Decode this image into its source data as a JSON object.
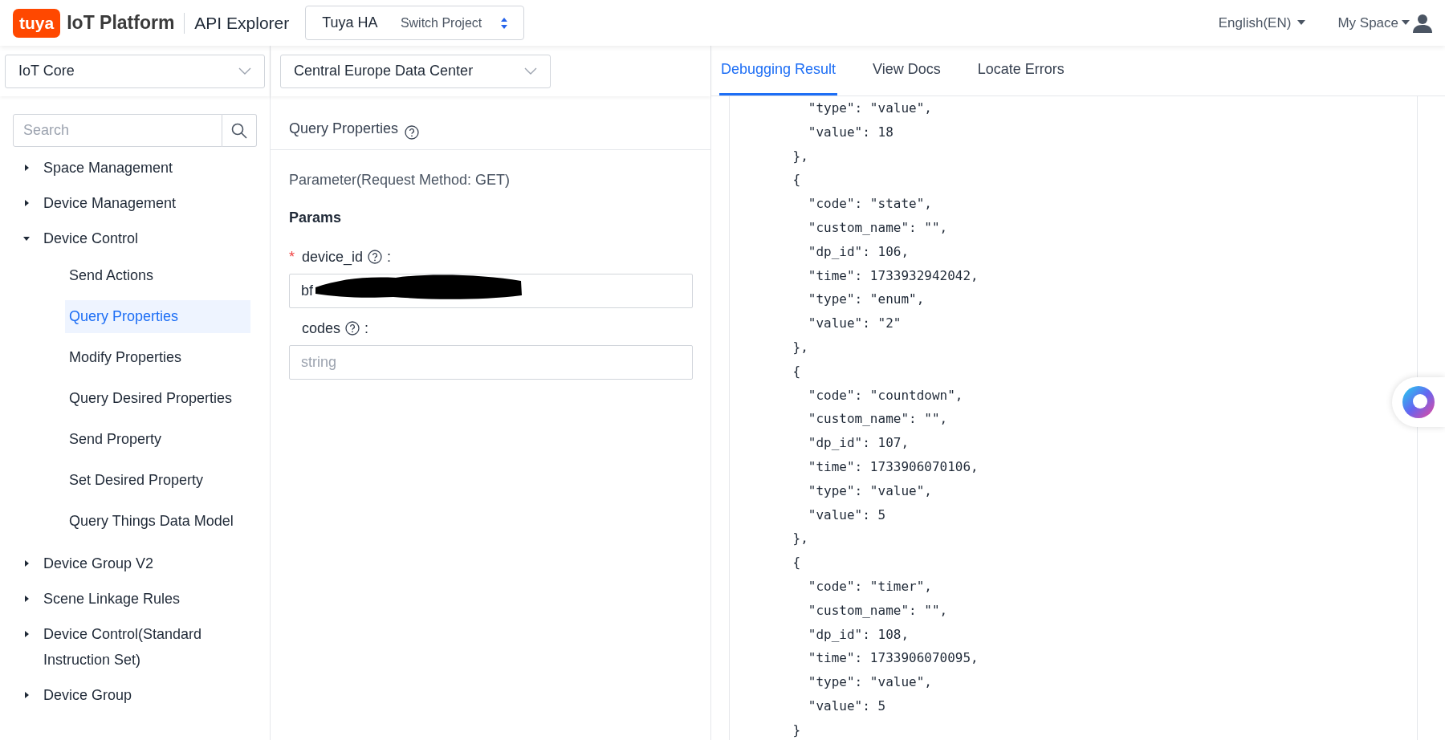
{
  "header": {
    "logo": "tuya",
    "product": "IoT Platform",
    "section": "API Explorer",
    "project": {
      "name": "Tuya HA",
      "action": "Switch Project"
    },
    "language": "English(EN)",
    "account": "My Space"
  },
  "selectors": [
    {
      "label": "IoT Core"
    },
    {
      "label": "Central Europe Data Center"
    }
  ],
  "sidebar": {
    "search": {
      "placeholder": "Search"
    },
    "items": [
      {
        "label": "Space Management",
        "expanded": false
      },
      {
        "label": "Device Management",
        "expanded": false
      },
      {
        "label": "Device Control",
        "expanded": true,
        "children": [
          {
            "label": "Send Actions",
            "selected": false
          },
          {
            "label": "Query Properties",
            "selected": true
          },
          {
            "label": "Modify Properties",
            "selected": false
          },
          {
            "label": "Query Desired Properties",
            "selected": false
          },
          {
            "label": "Send Property",
            "selected": false
          },
          {
            "label": "Set Desired Property",
            "selected": false
          },
          {
            "label": "Query Things Data Model",
            "selected": false
          }
        ]
      },
      {
        "label": "Device Group V2",
        "expanded": false
      },
      {
        "label": "Scene Linkage Rules",
        "expanded": false
      },
      {
        "label": "Device Control(Standard Instruction Set)",
        "expanded": false
      },
      {
        "label": "Device Group",
        "expanded": false
      }
    ]
  },
  "request": {
    "title": "Query Properties",
    "method": "Parameter(Request Method: GET)",
    "section": "Params",
    "params": [
      {
        "required_mark": "*",
        "name": "device_id",
        "colon": ":",
        "value": "bf",
        "redacted": true
      },
      {
        "name": "codes",
        "colon": ":",
        "placeholder": "string"
      }
    ]
  },
  "result": {
    "tabs": [
      {
        "label": "Debugging Result",
        "selected": true
      },
      {
        "label": "View Docs",
        "selected": false
      },
      {
        "label": "Locate Errors",
        "selected": false
      }
    ],
    "lines": [
      "      \"type\": \"value\",",
      "      \"value\": 18",
      "    },",
      "    {",
      "      \"code\": \"state\",",
      "      \"custom_name\": \"\",",
      "      \"dp_id\": 106,",
      "      \"time\": 1733932942042,",
      "      \"type\": \"enum\",",
      "      \"value\": \"2\"",
      "    },",
      "    {",
      "      \"code\": \"countdown\",",
      "      \"custom_name\": \"\",",
      "      \"dp_id\": 107,",
      "      \"time\": 1733906070106,",
      "      \"type\": \"value\",",
      "      \"value\": 5",
      "    },",
      "    {",
      "      \"code\": \"timer\",",
      "      \"custom_name\": \"\",",
      "      \"dp_id\": 108,",
      "      \"time\": 1733906070095,",
      "      \"type\": \"value\",",
      "      \"value\": 5",
      "    }"
    ]
  }
}
